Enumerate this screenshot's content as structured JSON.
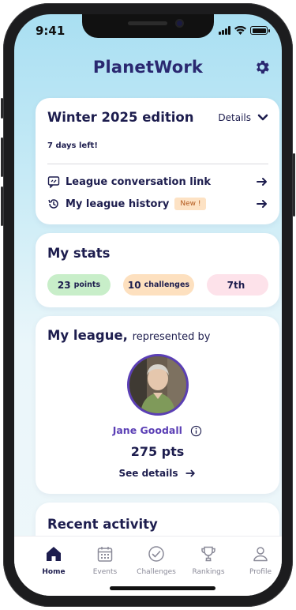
{
  "status_bar": {
    "time": "9:41"
  },
  "header": {
    "title": "PlanetWork",
    "settings_icon": "gear-icon"
  },
  "edition": {
    "title": "Winter 2025 edition",
    "details_label": "Details",
    "days_left": "7 days left!",
    "links": [
      {
        "label": "League conversation link",
        "icon": "chat-link-icon"
      },
      {
        "label": "My league history",
        "icon": "history-icon",
        "badge": "New !"
      }
    ]
  },
  "stats": {
    "title": "My stats",
    "points_value": "23",
    "points_unit": "points",
    "challenges_value": "10",
    "challenges_unit": "challenges",
    "rank": "7th",
    "colors": {
      "points": "#c8eec9",
      "challenges": "#fde0bf",
      "rank": "#fde2ea"
    }
  },
  "league": {
    "title": "My league,",
    "subtitle": "represented by",
    "person_name": "Jane Goodall",
    "points": "275 pts",
    "see_details": "See details"
  },
  "recent": {
    "title": "Recent activity"
  },
  "tabs": [
    {
      "label": "Home",
      "icon": "home-icon",
      "active": true
    },
    {
      "label": "Events",
      "icon": "calendar-icon",
      "active": false
    },
    {
      "label": "Challenges",
      "icon": "check-circle-icon",
      "active": false
    },
    {
      "label": "Rankings",
      "icon": "trophy-icon",
      "active": false
    },
    {
      "label": "Profile",
      "icon": "person-icon",
      "active": false
    }
  ],
  "colors": {
    "primary": "#2a2870",
    "accent": "#5b3fb5",
    "text": "#1d1d4e"
  }
}
